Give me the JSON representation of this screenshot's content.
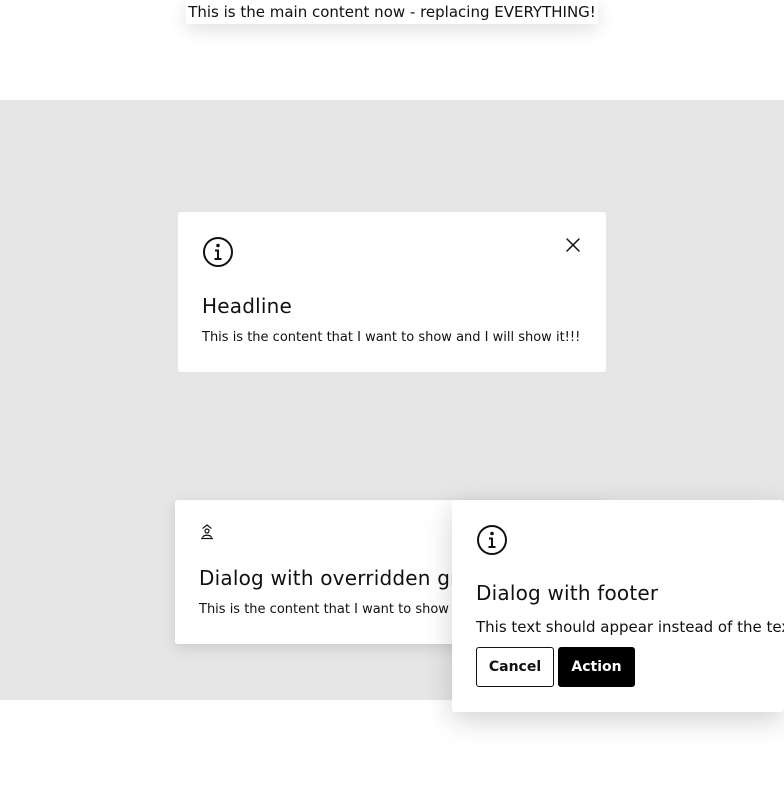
{
  "main": {
    "text": "This is the main content now - replacing EVERYTHING!"
  },
  "dialog_info": {
    "icon": "info-icon",
    "close_icon": "close-icon",
    "headline": "Headline",
    "content": "This is the content that I want to show and I will show it!!!"
  },
  "dialog_glyph": {
    "icon": "person-up-icon",
    "headline": "Dialog with overridden gr",
    "content": "This is the content that I want to show"
  },
  "dialog_footer": {
    "icon": "info-icon",
    "headline": "Dialog with footer",
    "content": "This text should appear instead of the tex",
    "cancel_label": "Cancel",
    "action_label": "Action"
  },
  "colors": {
    "stage_background": "#e6e6e6",
    "dialog_background": "#ffffff",
    "primary_button": "#000000",
    "text": "#111111"
  }
}
